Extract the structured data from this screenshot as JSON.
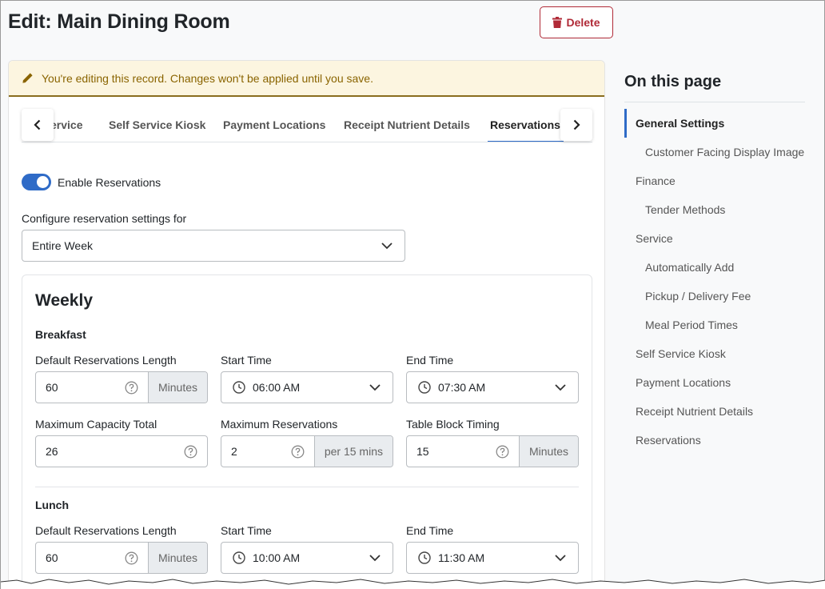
{
  "page": {
    "title": "Edit: Main Dining Room",
    "delete_label": "Delete"
  },
  "alert": {
    "text": "You're editing this record. Changes won't be applied until you save."
  },
  "tabs": [
    {
      "label": "ervice"
    },
    {
      "label": "Self Service Kiosk"
    },
    {
      "label": "Payment Locations"
    },
    {
      "label": "Receipt Nutrient Details"
    },
    {
      "label": "Reservations",
      "active": true
    }
  ],
  "reservations": {
    "enable_label": "Enable Reservations",
    "enabled": true,
    "configure_label": "Configure reservation settings for",
    "configure_value": "Entire Week"
  },
  "weekly": {
    "title": "Weekly",
    "breakfast": {
      "title": "Breakfast",
      "length_label": "Default Reservations Length",
      "length_value": "60",
      "length_unit": "Minutes",
      "start_label": "Start Time",
      "start_value": "06:00 AM",
      "end_label": "End Time",
      "end_value": "07:30 AM",
      "capacity_label": "Maximum Capacity Total",
      "capacity_value": "26",
      "maxres_label": "Maximum Reservations",
      "maxres_value": "2",
      "maxres_unit": "per 15 mins",
      "block_label": "Table Block Timing",
      "block_value": "15",
      "block_unit": "Minutes"
    },
    "lunch": {
      "title": "Lunch",
      "length_label": "Default Reservations Length",
      "length_value": "60",
      "length_unit": "Minutes",
      "start_label": "Start Time",
      "start_value": "10:00 AM",
      "end_label": "End Time",
      "end_value": "11:30 AM"
    }
  },
  "on_this_page": {
    "title": "On this page",
    "items": [
      {
        "label": "General Settings",
        "active": true
      },
      {
        "label": "Customer Facing Display Image"
      },
      {
        "label": "Finance"
      },
      {
        "label": "Tender Methods"
      },
      {
        "label": "Service"
      },
      {
        "label": "Automatically Add"
      },
      {
        "label": "Pickup / Delivery Fee"
      },
      {
        "label": "Meal Period Times"
      },
      {
        "label": "Self Service Kiosk"
      },
      {
        "label": "Payment Locations"
      },
      {
        "label": "Receipt Nutrient Details"
      },
      {
        "label": "Reservations"
      }
    ]
  },
  "colors": {
    "accent": "#2f6bc7",
    "danger": "#b02a37",
    "alert_bg": "#fcf5e0",
    "alert_text": "#8a6400"
  }
}
